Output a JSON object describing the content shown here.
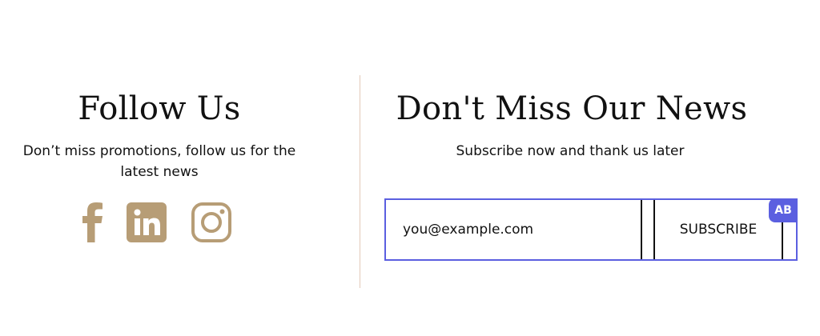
{
  "follow": {
    "title": "Follow Us",
    "text": "Don’t miss promotions, follow us for the latest news",
    "icons": {
      "facebook": "facebook-icon",
      "linkedin": "linkedin-icon",
      "instagram": "instagram-icon"
    },
    "icon_color": "#b79d76"
  },
  "divider_color": "#e2c9b9",
  "news": {
    "title": "Don't Miss Our News",
    "subtitle": "Subscribe now and thank us later",
    "email_placeholder": "you@example.com",
    "subscribe_label": "SUBSCRIBE",
    "badge_label": "AB",
    "accent_color": "#5b5fe0"
  }
}
